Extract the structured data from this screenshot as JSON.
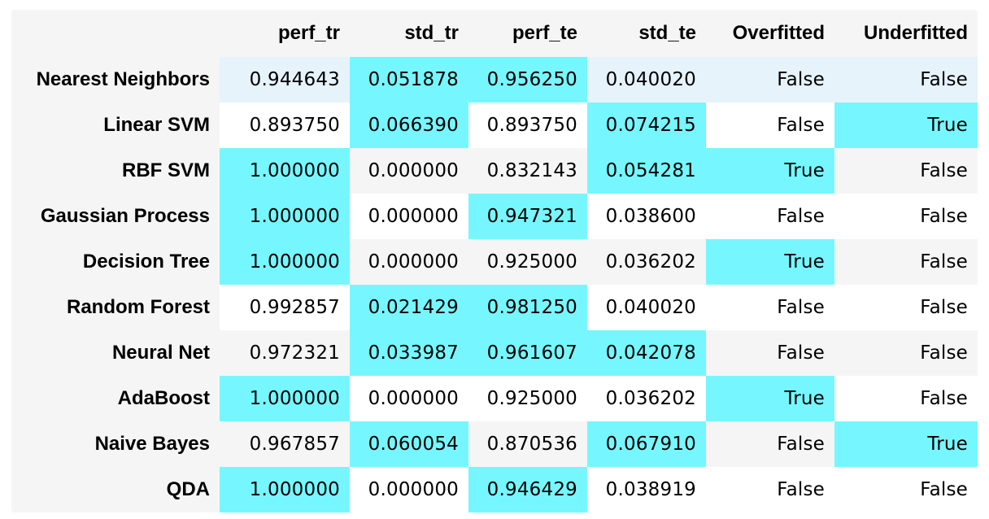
{
  "table": {
    "corner": "",
    "columns": [
      "perf_tr",
      "std_tr",
      "perf_te",
      "std_te",
      "Overfitted",
      "Underfitted"
    ],
    "highlight_color": "#76f7ff",
    "hover_row_color": "#e6f3fb",
    "rows": [
      {
        "label": "Nearest Neighbors",
        "cells": [
          "0.944643",
          "0.051878",
          "0.956250",
          "0.040020",
          "False",
          "False"
        ],
        "highlight": [
          false,
          true,
          true,
          false,
          false,
          false
        ],
        "hover": true
      },
      {
        "label": "Linear SVM",
        "cells": [
          "0.893750",
          "0.066390",
          "0.893750",
          "0.074215",
          "False",
          "True"
        ],
        "highlight": [
          false,
          true,
          false,
          true,
          false,
          true
        ]
      },
      {
        "label": "RBF SVM",
        "cells": [
          "1.000000",
          "0.000000",
          "0.832143",
          "0.054281",
          "True",
          "False"
        ],
        "highlight": [
          true,
          false,
          false,
          true,
          true,
          false
        ]
      },
      {
        "label": "Gaussian Process",
        "cells": [
          "1.000000",
          "0.000000",
          "0.947321",
          "0.038600",
          "False",
          "False"
        ],
        "highlight": [
          true,
          false,
          true,
          false,
          false,
          false
        ]
      },
      {
        "label": "Decision Tree",
        "cells": [
          "1.000000",
          "0.000000",
          "0.925000",
          "0.036202",
          "True",
          "False"
        ],
        "highlight": [
          true,
          false,
          false,
          false,
          true,
          false
        ]
      },
      {
        "label": "Random Forest",
        "cells": [
          "0.992857",
          "0.021429",
          "0.981250",
          "0.040020",
          "False",
          "False"
        ],
        "highlight": [
          false,
          true,
          true,
          false,
          false,
          false
        ]
      },
      {
        "label": "Neural Net",
        "cells": [
          "0.972321",
          "0.033987",
          "0.961607",
          "0.042078",
          "False",
          "False"
        ],
        "highlight": [
          false,
          true,
          true,
          true,
          false,
          false
        ]
      },
      {
        "label": "AdaBoost",
        "cells": [
          "1.000000",
          "0.000000",
          "0.925000",
          "0.036202",
          "True",
          "False"
        ],
        "highlight": [
          true,
          false,
          false,
          false,
          true,
          false
        ]
      },
      {
        "label": "Naive Bayes",
        "cells": [
          "0.967857",
          "0.060054",
          "0.870536",
          "0.067910",
          "False",
          "True"
        ],
        "highlight": [
          false,
          true,
          false,
          true,
          false,
          true
        ]
      },
      {
        "label": "QDA",
        "cells": [
          "1.000000",
          "0.000000",
          "0.946429",
          "0.038919",
          "False",
          "False"
        ],
        "highlight": [
          true,
          false,
          true,
          false,
          false,
          false
        ]
      }
    ]
  }
}
